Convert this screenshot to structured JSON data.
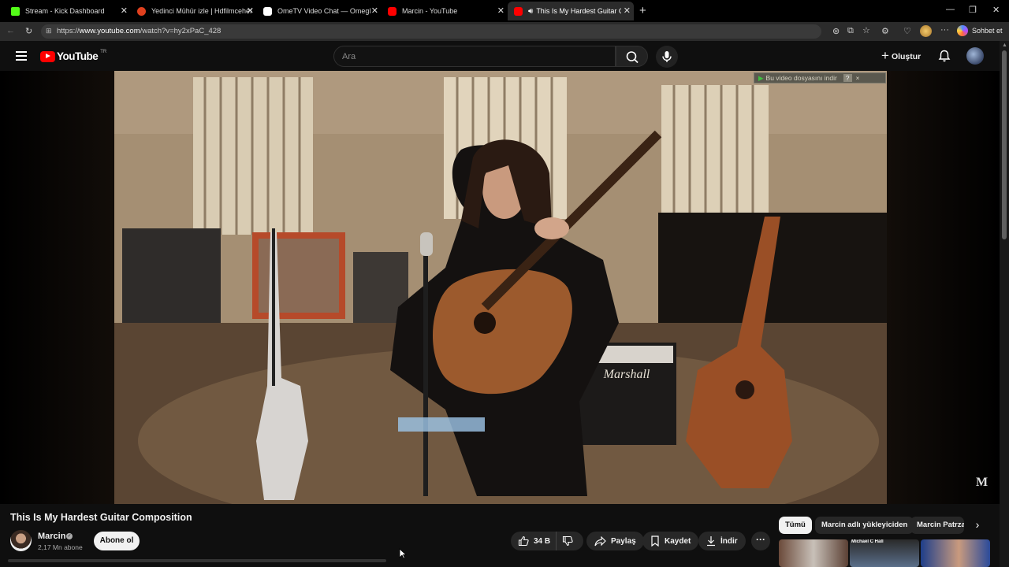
{
  "browser": {
    "tabs": [
      {
        "title": "Stream - Kick Dashboard",
        "active": false,
        "favicon_color": "#53fc18"
      },
      {
        "title": "Yedinci Mühür izle | Hdfilmcehenn",
        "active": false,
        "favicon_color": "#e0401e"
      },
      {
        "title": "OmeTV Video Chat — Omegl",
        "active": false,
        "favicon_color": "#ffffff"
      },
      {
        "title": "Marcin - YouTube",
        "active": false,
        "favicon_color": "#ff0000"
      },
      {
        "title": "This Is My Hardest Guitar Con",
        "active": true,
        "favicon_color": "#ff0000"
      }
    ],
    "url_prefix": "https://",
    "url_host": "www.youtube.com",
    "url_path": "/watch?v=hy2xPaC_428",
    "copilot_label": "Sohbet et"
  },
  "youtube": {
    "logo_text": "YouTube",
    "country_code": "TR",
    "search_placeholder": "Ara",
    "create_label": "Oluştur"
  },
  "player": {
    "download_overlay": "Bu video dosyasını indir",
    "download_overlay_help": "?",
    "download_overlay_close": "×",
    "watermark": "M"
  },
  "video": {
    "title": "This Is My Hardest Guitar Composition",
    "channel": "Marcin",
    "subscribers": "2,17 Mn abone",
    "subscribe_label": "Abone ol",
    "likes": "34 B",
    "share_label": "Paylaş",
    "save_label": "Kaydet",
    "download_label": "İndir",
    "more_label": "···"
  },
  "chips": [
    "Tümü",
    "Marcin adlı yükleyiciden",
    "Marcin Patrza"
  ],
  "related_thumbs": [
    {
      "caption": ""
    },
    {
      "caption": "Michael C Hall"
    },
    {
      "caption": ""
    }
  ],
  "colors": {
    "accent": "#ff0000",
    "background": "#0f0f0f",
    "chip_active": "#f1f1f1",
    "pill": "#272727"
  }
}
